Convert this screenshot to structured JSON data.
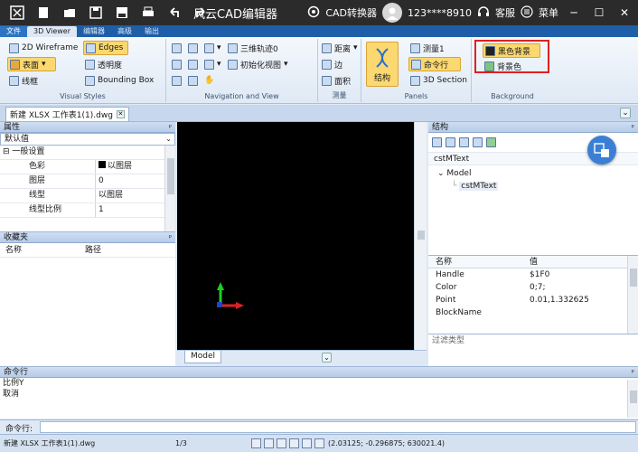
{
  "window": {
    "title": "风云CAD编辑器",
    "converter_label": "CAD转换器",
    "user_name": "123****8910",
    "service_label": "客服",
    "menu_label": "菜单"
  },
  "tabs": [
    "文件",
    "3D Viewer",
    "编辑器",
    "高级",
    "输出"
  ],
  "ribbon": {
    "visual_styles": {
      "label": "Visual Styles",
      "wireframe": "2D Wireframe",
      "surface": "表面",
      "lines": "线框",
      "edges": "Edges",
      "transparency": "透明度",
      "bounding_box": "Bounding Box"
    },
    "navigation": {
      "label": "Navigation and View",
      "orbit": "三维轨迹0",
      "init_view": "初始化视图"
    },
    "measure": {
      "label": "测量",
      "distance": "距离",
      "edge": "边",
      "area": "面积"
    },
    "panels": {
      "label": "Panels",
      "structure": "结构",
      "measure1": "测量1",
      "command_line": "命令行",
      "section": "3D Section"
    },
    "background": {
      "label": "Background",
      "black_bg": "黑色背景",
      "bg_color": "背景色"
    }
  },
  "document_tab": "新建 XLSX 工作表1(1).dwg",
  "properties": {
    "title": "属性",
    "selector": "默认值",
    "category": "一般设置",
    "rows": [
      {
        "key": "色彩",
        "value": "以图层"
      },
      {
        "key": "图层",
        "value": "0"
      },
      {
        "key": "线型",
        "value": "以图层"
      },
      {
        "key": "线型比例",
        "value": "1"
      }
    ]
  },
  "favorites": {
    "title": "收藏夹",
    "col_name": "名称",
    "col_path": "路径"
  },
  "viewport": {
    "model_tab": "Model"
  },
  "structure": {
    "title": "结构",
    "crumb": "cstMText",
    "root": "Model",
    "child": "cstMText"
  },
  "details": {
    "col_name": "名称",
    "col_value": "值",
    "rows": [
      {
        "key": "Handle",
        "value": "$1F0"
      },
      {
        "key": "Color",
        "value": "0;7;"
      },
      {
        "key": "Point",
        "value": "0.01,1.332625"
      },
      {
        "key": "BlockName",
        "value": ""
      }
    ],
    "filter_placeholder": "过滤类型"
  },
  "command": {
    "title": "命令行",
    "lines": [
      "比例Y",
      "取消"
    ],
    "input_label": "命令行:"
  },
  "status": {
    "file": "新建 XLSX 工作表1(1).dwg",
    "page": "1/3",
    "coords": "(2.03125; -0.296875; 630021.4)"
  },
  "colors": {
    "titlebar": "#2b2b2b",
    "tabbar": "#1e5ea8",
    "highlight": "#fbd870",
    "red_frame": "#e02020"
  }
}
